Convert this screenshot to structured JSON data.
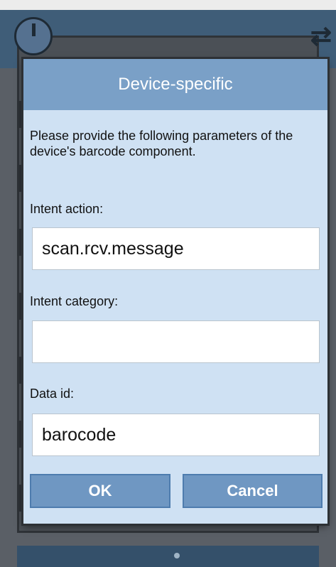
{
  "dialog": {
    "title": "Device-specific",
    "message": "Please provide the following parameters of the device's barcode component.",
    "fields": [
      {
        "label": "Intent action:",
        "value": "scan.rcv.message",
        "placeholder": ""
      },
      {
        "label": "Intent category:",
        "value": "",
        "placeholder": ""
      },
      {
        "label": "Data id:",
        "value": "barocode",
        "placeholder": ""
      }
    ],
    "buttons": {
      "ok": "OK",
      "cancel": "Cancel"
    }
  },
  "background_app": {
    "power_icon": "power-icon",
    "sync_icon": "sync-icon"
  },
  "colors": {
    "dialog_background": "#cfe1f3",
    "header_background": "#7aa0c7",
    "button_background": "#6f97c2"
  }
}
